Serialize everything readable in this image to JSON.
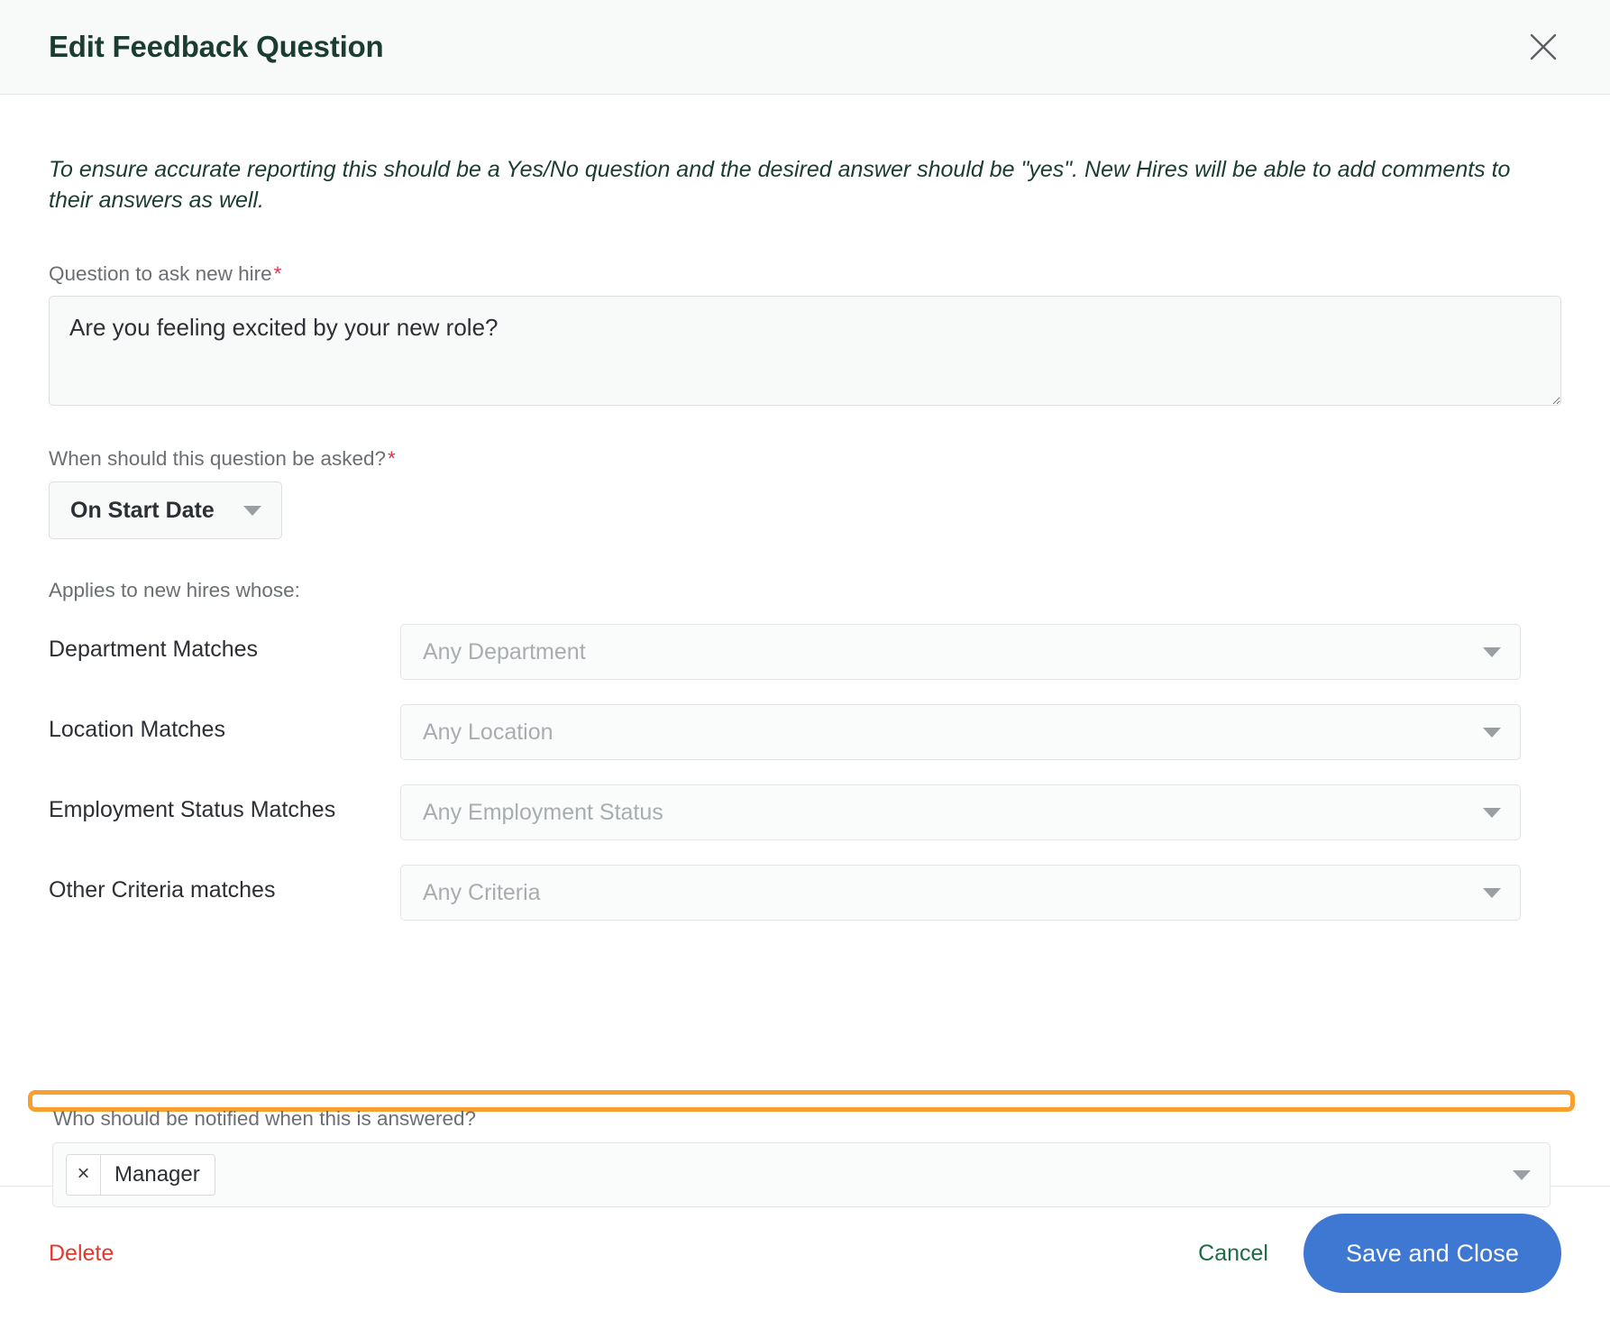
{
  "header": {
    "title": "Edit Feedback Question",
    "close_icon": "close-icon"
  },
  "body": {
    "intro": "To ensure accurate reporting this should be a Yes/No question and the desired answer should be \"yes\". New Hires will be able to add comments to their answers as well.",
    "question_field": {
      "label": "Question to ask new hire",
      "required_marker": "*",
      "value": "Are you feeling excited by your new role?",
      "placeholder": ""
    },
    "when_field": {
      "label": "When should this question be asked?",
      "required_marker": "*",
      "selected": "On Start Date"
    },
    "applies_label": "Applies to new hires whose:",
    "criteria": [
      {
        "name": "Department Matches",
        "placeholder": "Any Department"
      },
      {
        "name": "Location Matches",
        "placeholder": "Any Location"
      },
      {
        "name": "Employment Status Matches",
        "placeholder": "Any Employment Status"
      },
      {
        "name": "Other Criteria matches",
        "placeholder": "Any Criteria"
      }
    ],
    "notify": {
      "label": "Who should be notified when this is answered?",
      "tags": [
        {
          "label": "Manager",
          "remove_icon": "close-icon"
        }
      ],
      "highlight_color": "#f8a02e"
    }
  },
  "footer": {
    "delete_label": "Delete",
    "cancel_label": "Cancel",
    "save_label": "Save and Close",
    "delete_color": "#e03a2f",
    "cancel_color": "#1b6b43",
    "save_color": "#3f78d3"
  }
}
